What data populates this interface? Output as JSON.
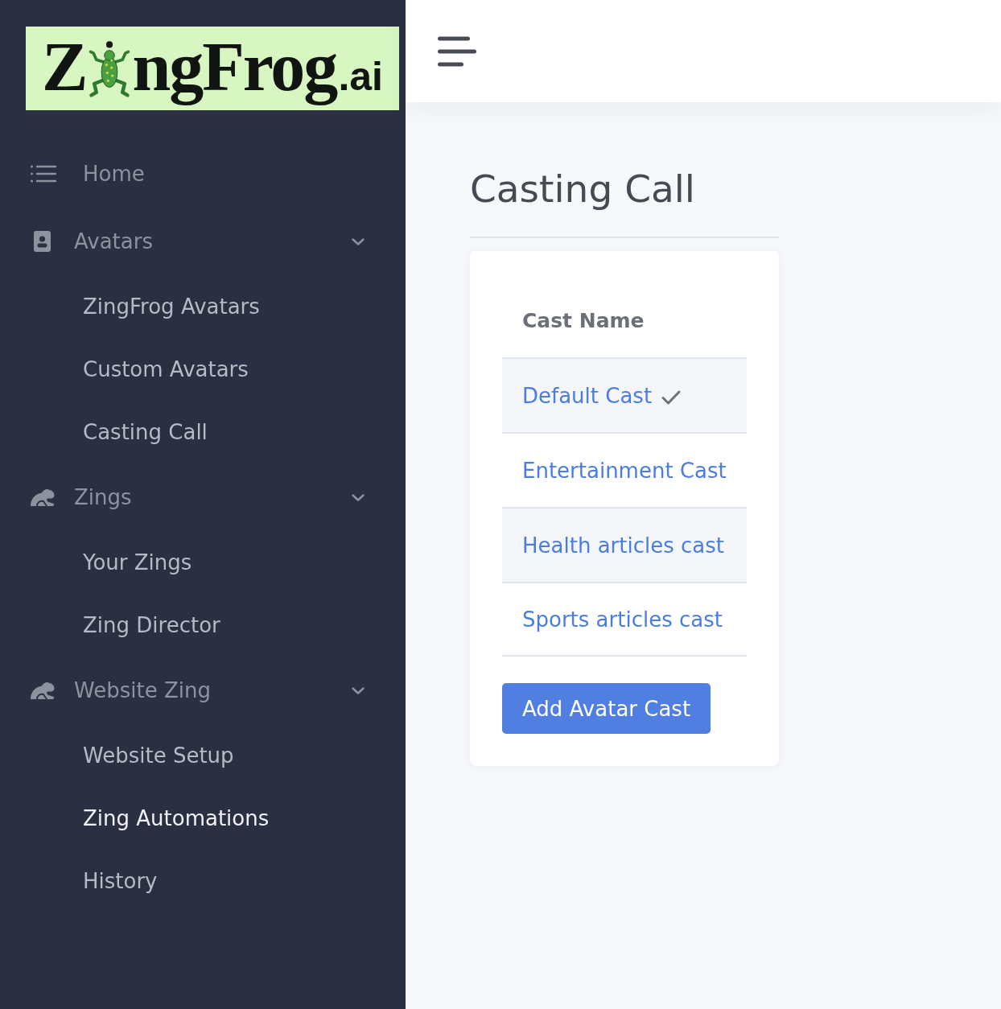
{
  "logo": {
    "text_start": "Z",
    "text_end": "ngFrog",
    "suffix": ".ai"
  },
  "sidebar": {
    "items": [
      {
        "kind": "link",
        "label": "Home",
        "selected": false
      },
      {
        "kind": "group",
        "label": "Avatars",
        "selected": false,
        "expanded": true,
        "children": [
          {
            "label": "ZingFrog Avatars",
            "selected": false
          },
          {
            "label": "Custom Avatars",
            "selected": false
          },
          {
            "label": "Casting Call",
            "selected": false
          }
        ]
      },
      {
        "kind": "group",
        "label": "Zings",
        "selected": false,
        "expanded": true,
        "children": [
          {
            "label": "Your Zings",
            "selected": false
          },
          {
            "label": "Zing Director",
            "selected": false
          }
        ]
      },
      {
        "kind": "group",
        "label": "Website Zing",
        "selected": false,
        "expanded": true,
        "children": [
          {
            "label": "Website Setup",
            "selected": false
          },
          {
            "label": "Zing Automations",
            "selected": true
          },
          {
            "label": "History",
            "selected": false
          }
        ]
      }
    ]
  },
  "page": {
    "title": "Casting Call"
  },
  "table": {
    "columns": [
      "Cast Name"
    ],
    "rows": [
      {
        "name": "Default Cast",
        "checked": true
      },
      {
        "name": "Entertainment Cast",
        "checked": false
      },
      {
        "name": "Health articles cast",
        "checked": false
      },
      {
        "name": "Sports articles cast",
        "checked": false
      }
    ]
  },
  "add_button": {
    "label": "Add Avatar Cast"
  }
}
